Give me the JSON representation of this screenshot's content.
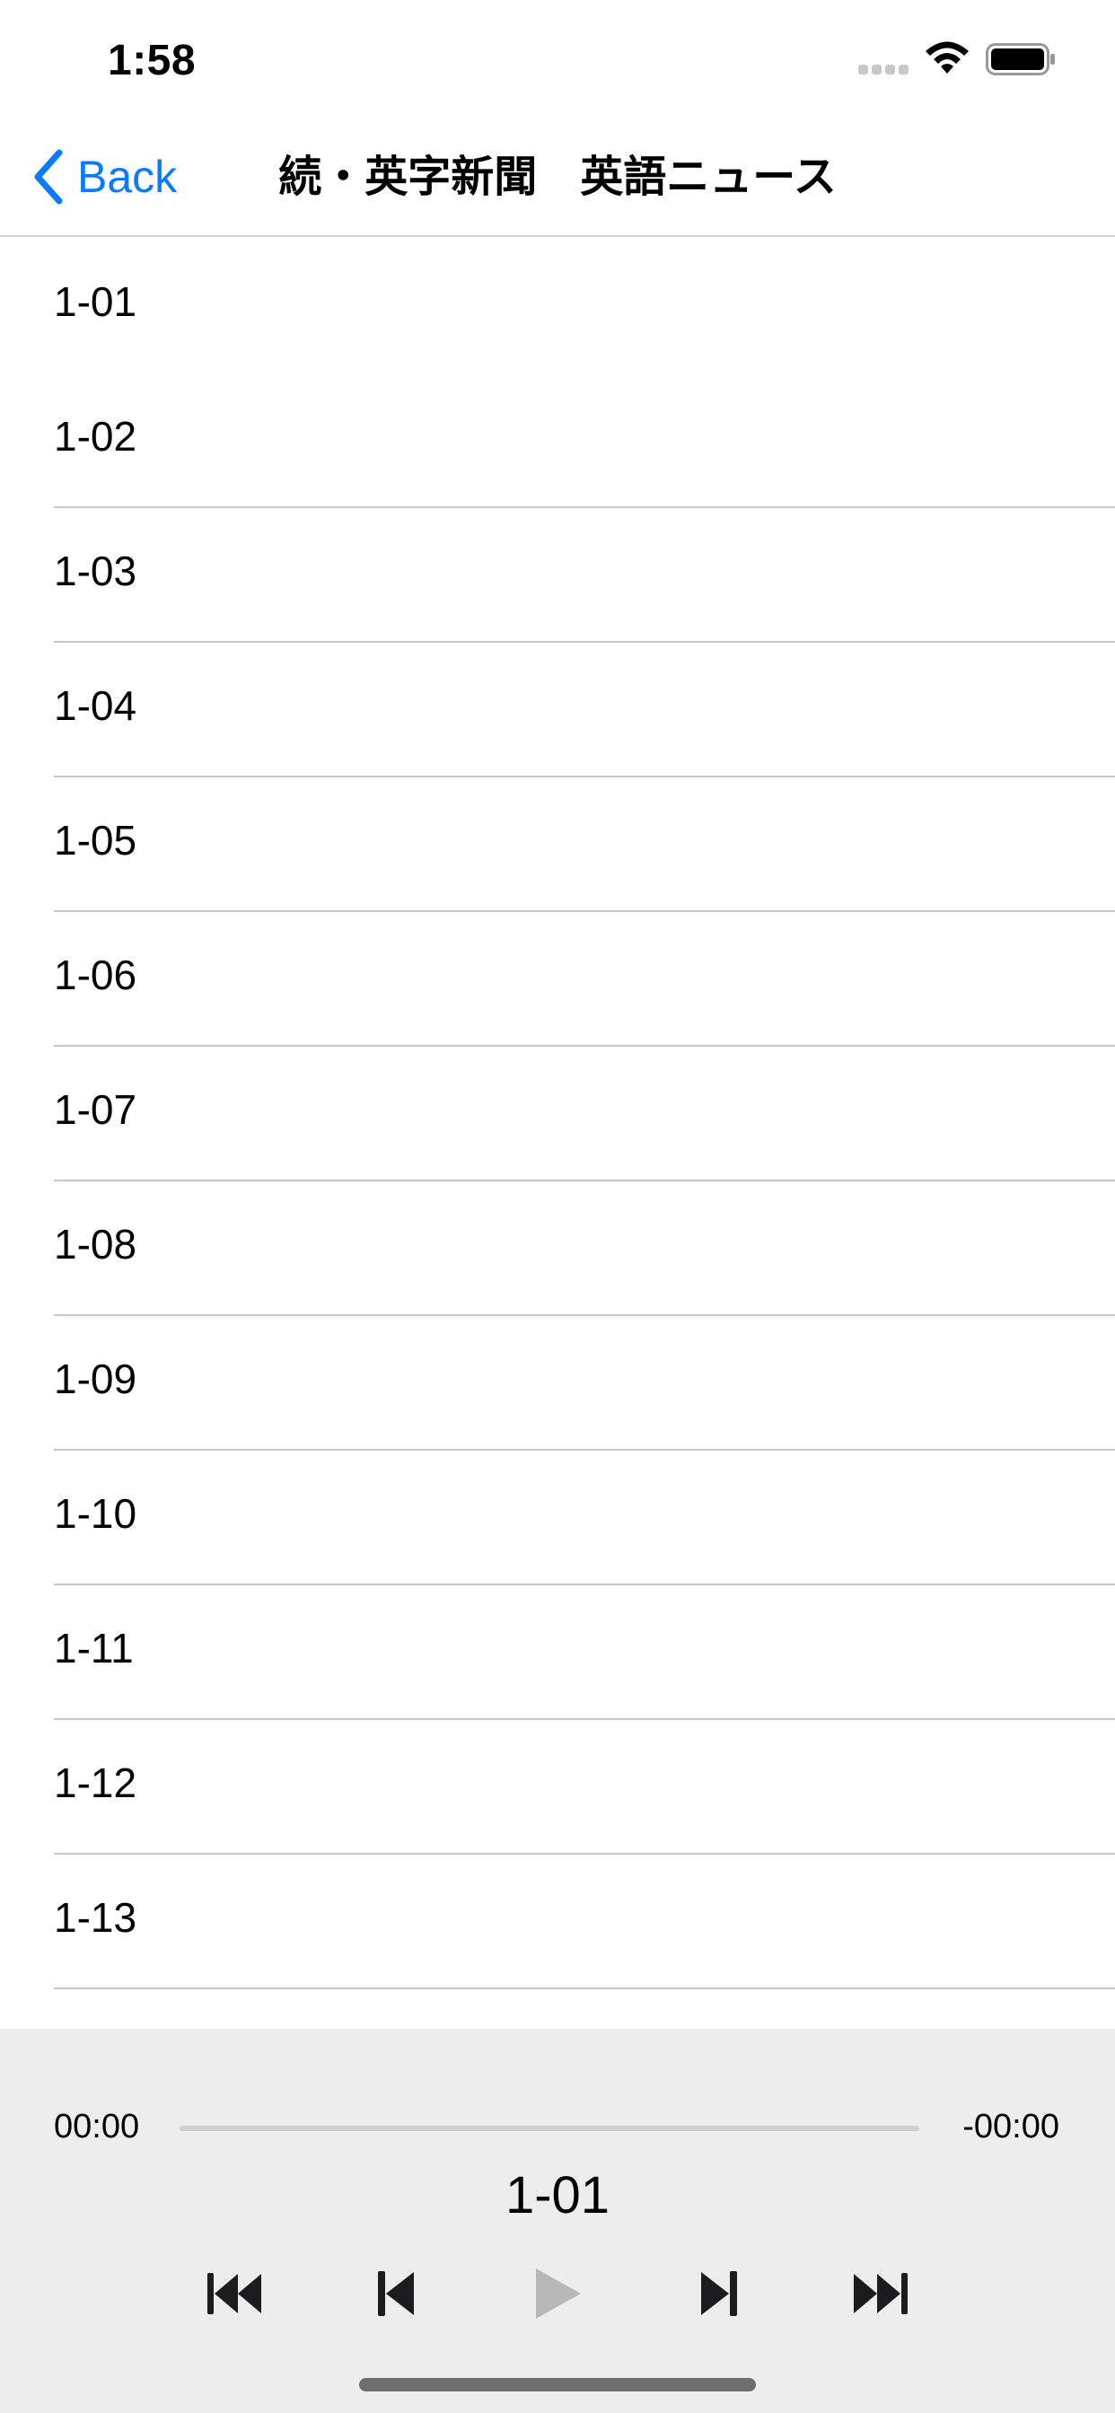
{
  "status_bar": {
    "time": "1:58"
  },
  "nav": {
    "back_label": "Back",
    "title": "続・英字新聞　英語ニュース"
  },
  "list": {
    "items": [
      "1-01",
      "1-02",
      "1-03",
      "1-04",
      "1-05",
      "1-06",
      "1-07",
      "1-08",
      "1-09",
      "1-10",
      "1-11",
      "1-12",
      "1-13"
    ]
  },
  "player": {
    "elapsed": "00:00",
    "remaining": "-00:00",
    "progress_fraction": 0,
    "track_title": "1-01",
    "play_disabled": true
  },
  "colors": {
    "accent": "#0a7aff",
    "player_bg": "#ededed",
    "disabled": "#b8b8b8"
  },
  "icons": [
    "wifi-icon",
    "battery-icon",
    "signal-icon",
    "back-chevron-icon",
    "skip-to-start-icon",
    "previous-track-icon",
    "play-icon",
    "next-track-icon",
    "skip-to-end-icon"
  ]
}
